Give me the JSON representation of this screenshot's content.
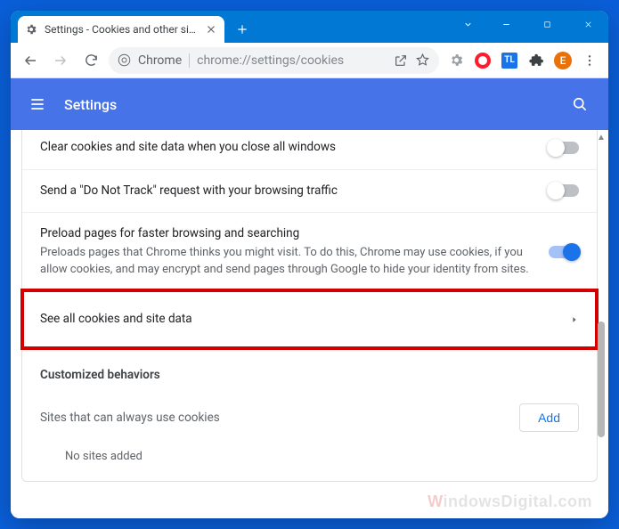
{
  "tab": {
    "title": "Settings - Cookies and other site"
  },
  "omnibox": {
    "product": "Chrome",
    "url": "chrome://settings/cookies"
  },
  "profile_initial": "E",
  "ext_tl_label": "TL",
  "settings": {
    "title": "Settings"
  },
  "rows": {
    "clear_on_close": "Clear cookies and site data when you close all windows",
    "dnt": "Send a \"Do Not Track\" request with your browsing traffic",
    "preload_title": "Preload pages for faster browsing and searching",
    "preload_desc": "Preloads pages that Chrome thinks you might visit. To do this, Chrome may use cookies, if you allow cookies, and may encrypt and send pages through Google to hide your identity from sites.",
    "see_all": "See all cookies and site data",
    "customized": "Customized behaviors",
    "allow_label": "Sites that can always use cookies",
    "add": "Add",
    "no_sites": "No sites added"
  },
  "watermark": "WindowsDigital.com"
}
